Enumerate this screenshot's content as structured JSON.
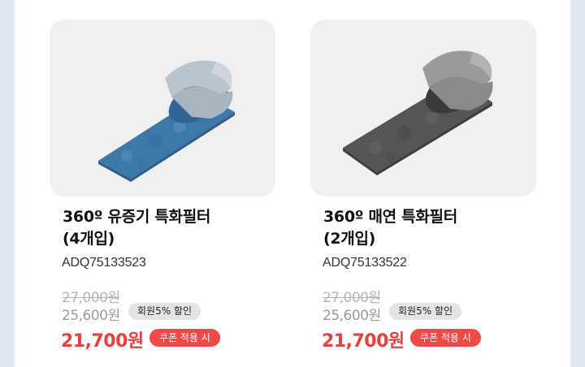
{
  "products": [
    {
      "title_line1": "360º 유증기 특화필터",
      "title_line2": "(4개입)",
      "model": "ADQ75133523",
      "original_price": "27,000원",
      "member_price": "25,600원",
      "member_badge": "회원5% 할인",
      "final_price": "21,700원",
      "coupon_badge": "쿠폰 적용 시",
      "filter_color": "#4f86b3"
    },
    {
      "title_line1": "360º 매연 특화필터",
      "title_line2": "(2개입)",
      "model": "ADQ75133522",
      "original_price": "27,000원",
      "member_price": "25,600원",
      "member_badge": "회원5% 할인",
      "final_price": "21,700원",
      "coupon_badge": "쿠폰 적용 시",
      "filter_color": "#5a5a5a"
    }
  ]
}
